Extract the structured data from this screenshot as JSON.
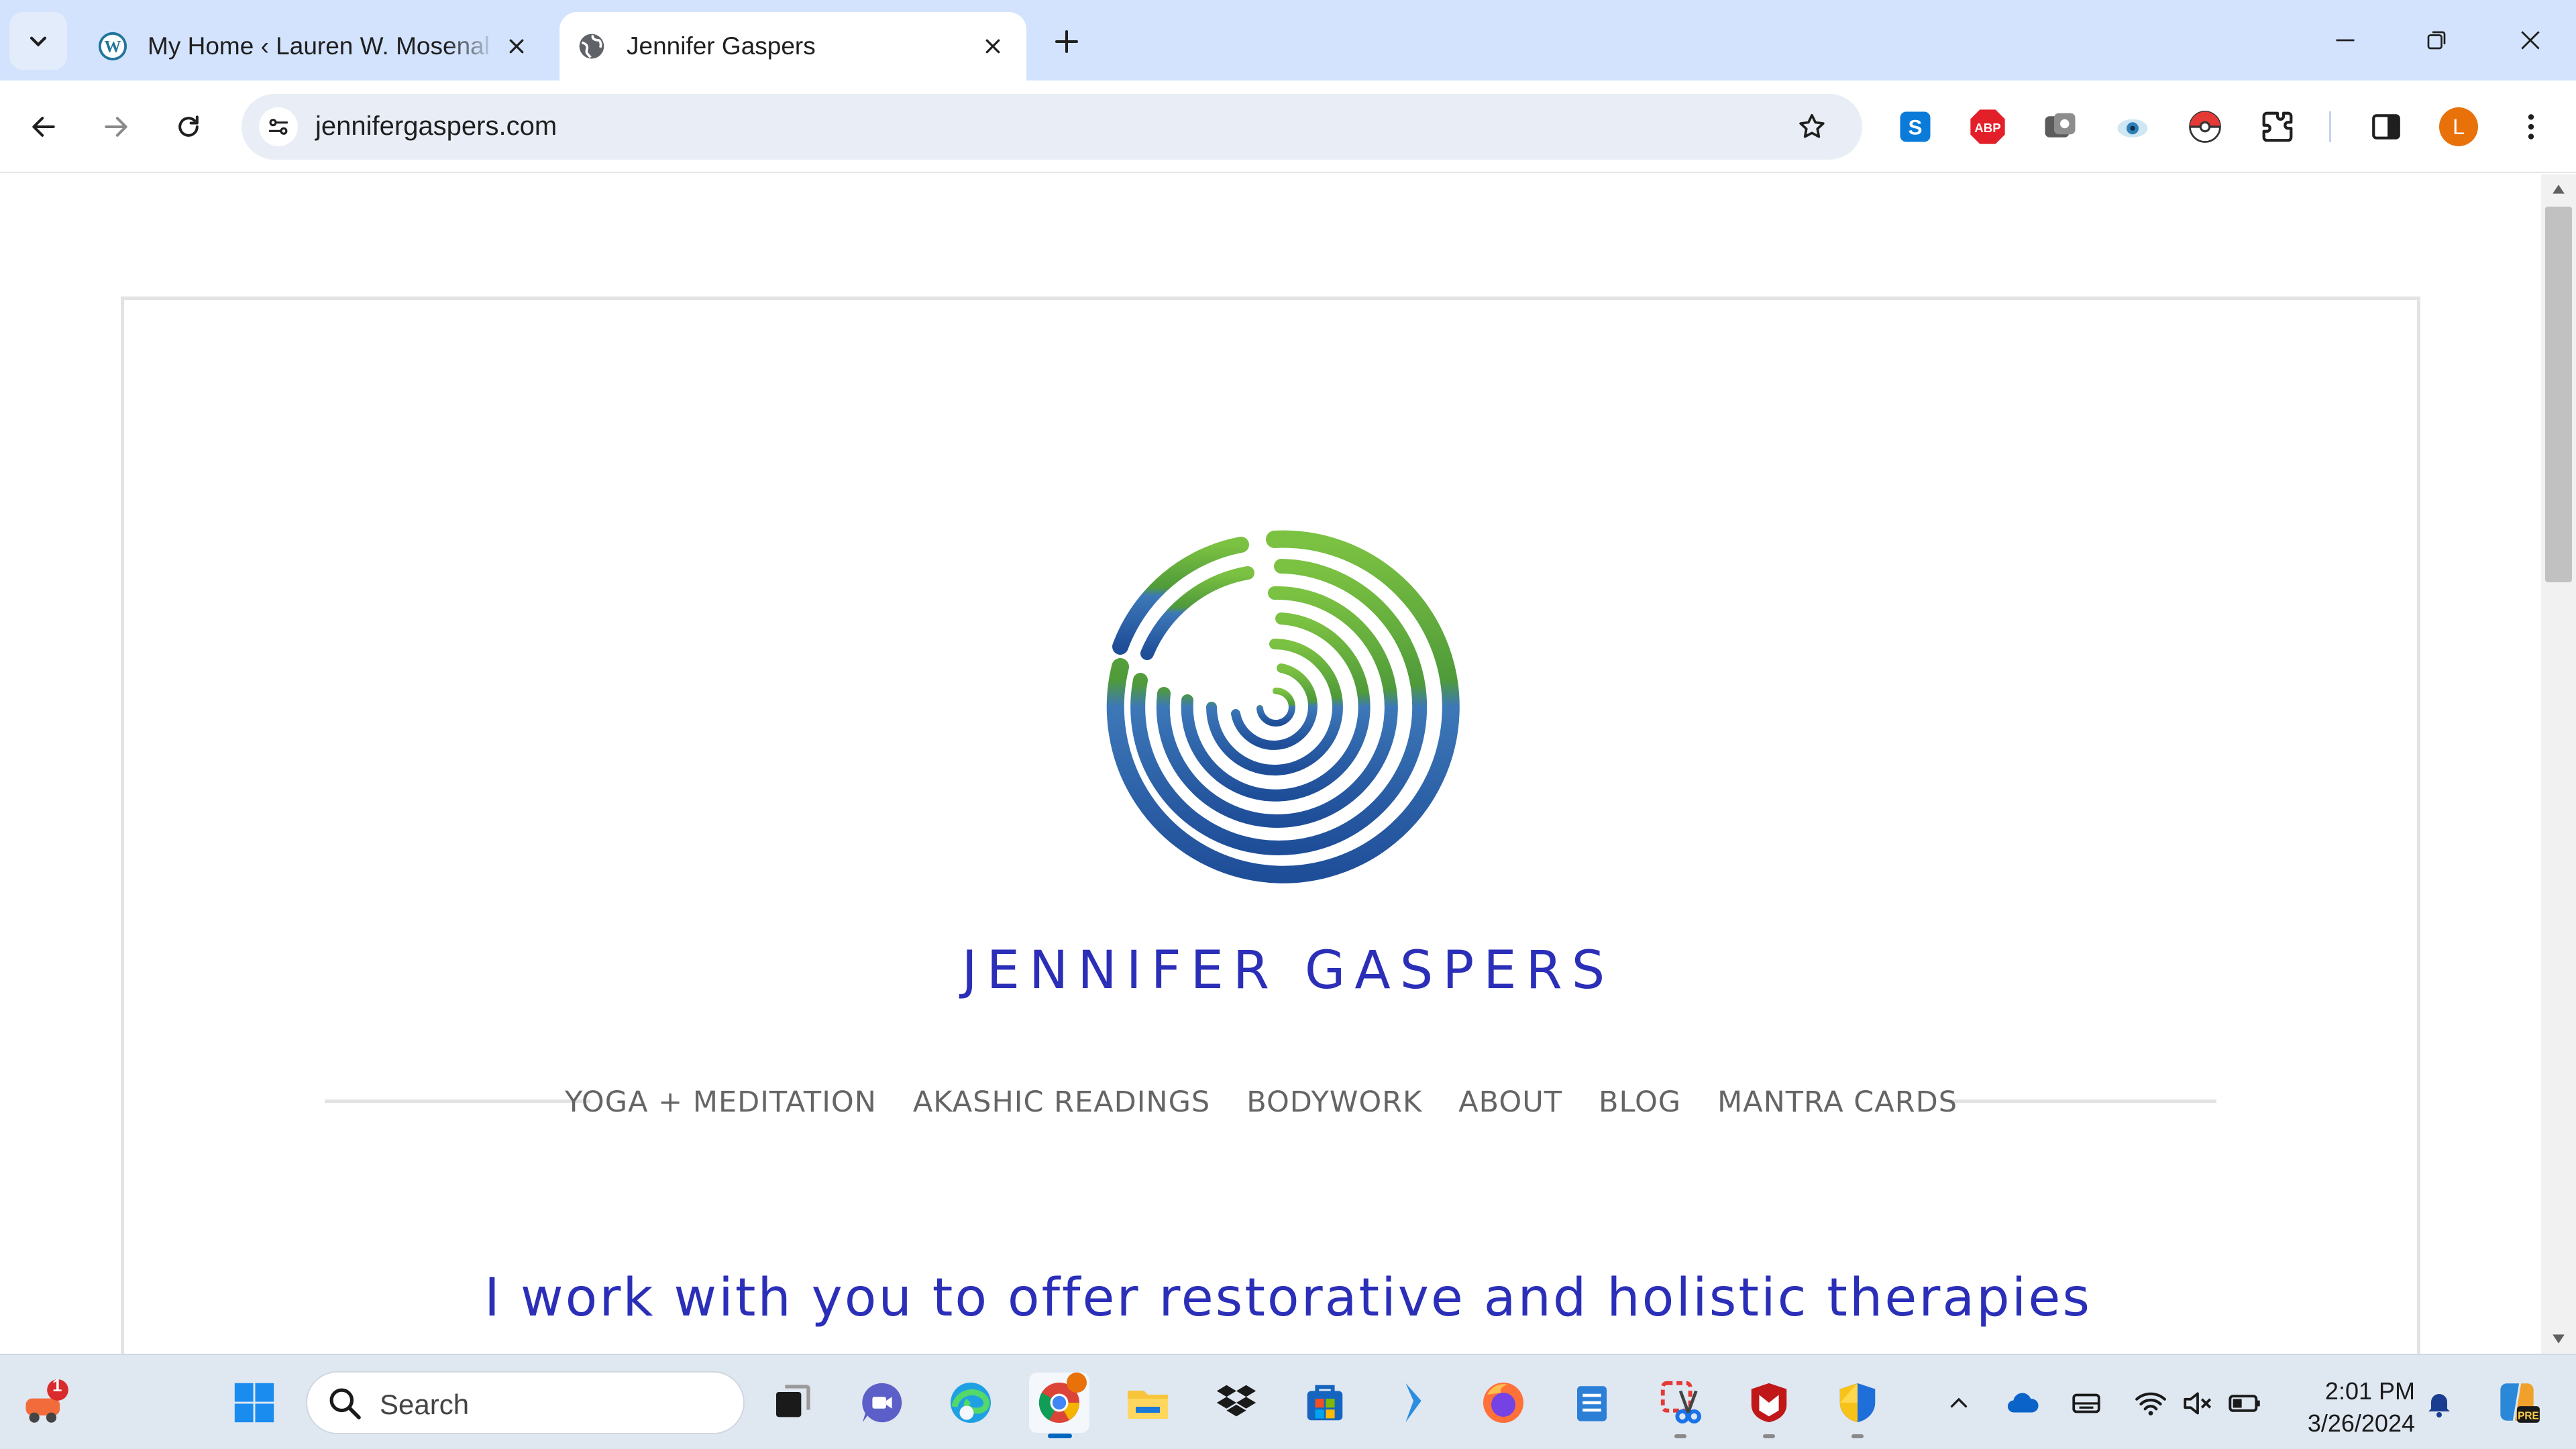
{
  "browser": {
    "tabs": [
      {
        "title": "My Home ‹ Lauren W. Mosenal — WordPress.com",
        "favicon": "wordpress-icon",
        "active": false
      },
      {
        "title": "Jennifer Gaspers",
        "favicon": "globe-icon",
        "active": true
      }
    ],
    "address_bar": {
      "url": "jennifergaspers.com"
    },
    "profile_initial": "L",
    "extensions": [
      "skype-extension-icon",
      "adblock-plus-icon",
      "screen-capture-icon",
      "eye-dropper-icon",
      "pokeball-icon",
      "extensions-puzzle-icon"
    ],
    "colors": {
      "tabstrip": "#d3e3fd",
      "omnibox": "#e9eef6",
      "profile": "#e8710a"
    }
  },
  "site": {
    "name": "JENNIFER GASPERS",
    "nav": [
      "YOGA + MEDITATION",
      "AKASHIC READINGS",
      "BODYWORK",
      "ABOUT",
      "BLOG",
      "MANTRA CARDS"
    ],
    "tagline": "I work with you to offer restorative and holistic therapies",
    "colors": {
      "brand_text": "#2b2fb8",
      "nav_text": "#656565",
      "logo_green": "#6fb23a",
      "logo_blue": "#2c63b8"
    }
  },
  "taskbar": {
    "search_placeholder": "Search",
    "notification_badge": "1",
    "clock_time": "2:01 PM",
    "clock_date": "3/26/2024",
    "apps": [
      "start-icon",
      "task-view-icon",
      "teams-chat-icon",
      "edge-icon",
      "chrome-icon",
      "file-explorer-icon",
      "dropbox-icon",
      "microsoft-store-icon",
      "visual-studio-icon",
      "firefox-icon",
      "notepad-icon",
      "snipping-tool-icon",
      "mcafee-icon",
      "defender-shield-icon"
    ]
  }
}
